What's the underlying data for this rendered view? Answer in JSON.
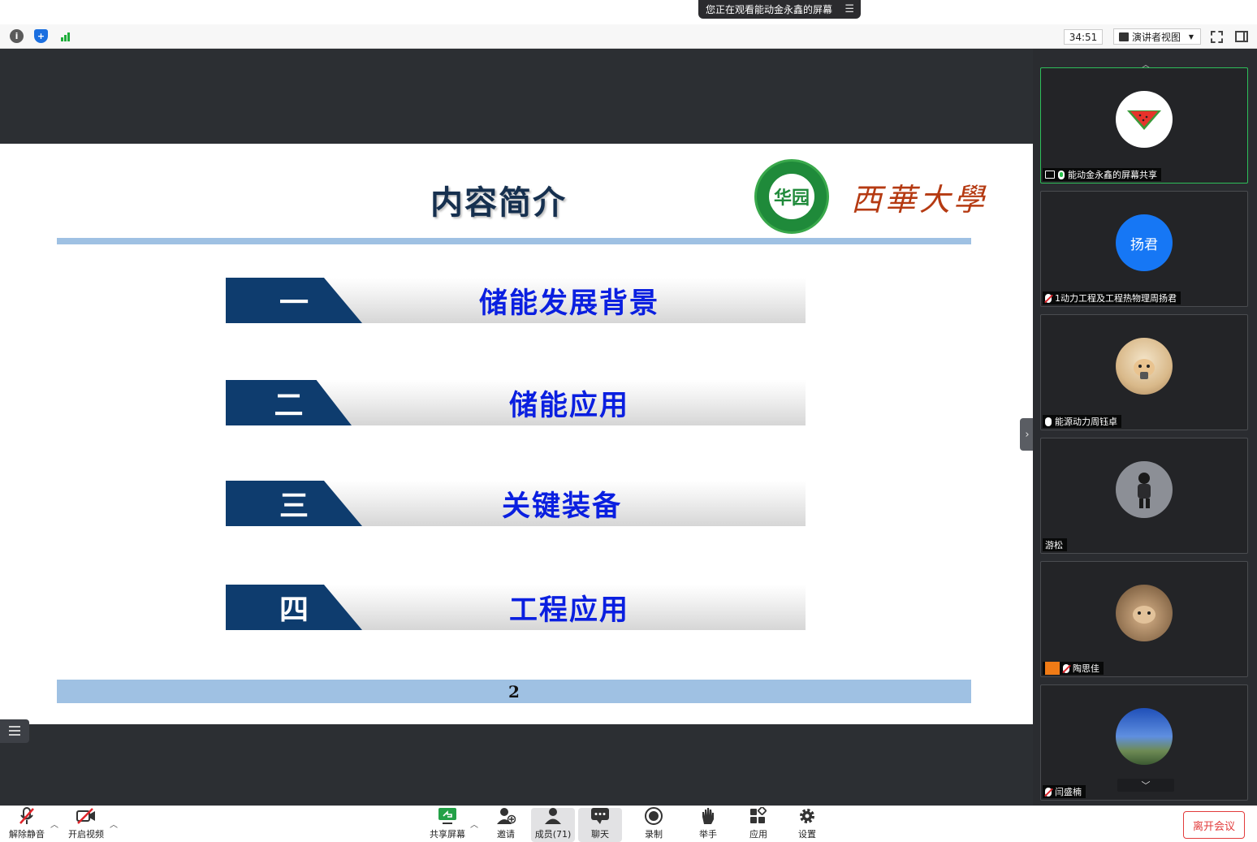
{
  "banner": {
    "text": "您正在观看能动金永鑫的屏幕"
  },
  "topbar": {
    "timer": "34:51",
    "view_label": "演讲者视图"
  },
  "slide": {
    "title": "内容简介",
    "logo_inner": "华园",
    "logo_text": "西華大學",
    "items": [
      {
        "num": "一",
        "label": "储能发展背景"
      },
      {
        "num": "二",
        "label": "储能应用"
      },
      {
        "num": "三",
        "label": "关键装备"
      },
      {
        "num": "四",
        "label": "工程应用"
      }
    ],
    "page_number": "2"
  },
  "gallery": {
    "participants": [
      {
        "name": "能动金永鑫的屏幕共享",
        "avatar": "watermelon",
        "mic": "on",
        "sharing": true,
        "active": true
      },
      {
        "name": "1动力工程及工程热物理周扬君",
        "avatar_text": "扬君",
        "avatar_color": "#1677f5",
        "mic": "off"
      },
      {
        "name": "能源动力周钰卓",
        "avatar": "dog-photo",
        "mic": "on-plain"
      },
      {
        "name": "游松",
        "avatar": "person-photo",
        "mic": "none"
      },
      {
        "name": "陶思佳",
        "avatar": "hamster-photo",
        "mic": "off",
        "person_icon": true
      },
      {
        "name": "闫盛楠",
        "avatar": "landscape-photo",
        "mic": "off"
      }
    ]
  },
  "toolbar": {
    "unmute": "解除静音",
    "start_video": "开启视频",
    "share_screen": "共享屏幕",
    "invite": "邀请",
    "members": "成员(71)",
    "chat": "聊天",
    "record": "录制",
    "raise_hand": "举手",
    "apps": "应用",
    "settings": "设置",
    "leave": "离开会议"
  }
}
